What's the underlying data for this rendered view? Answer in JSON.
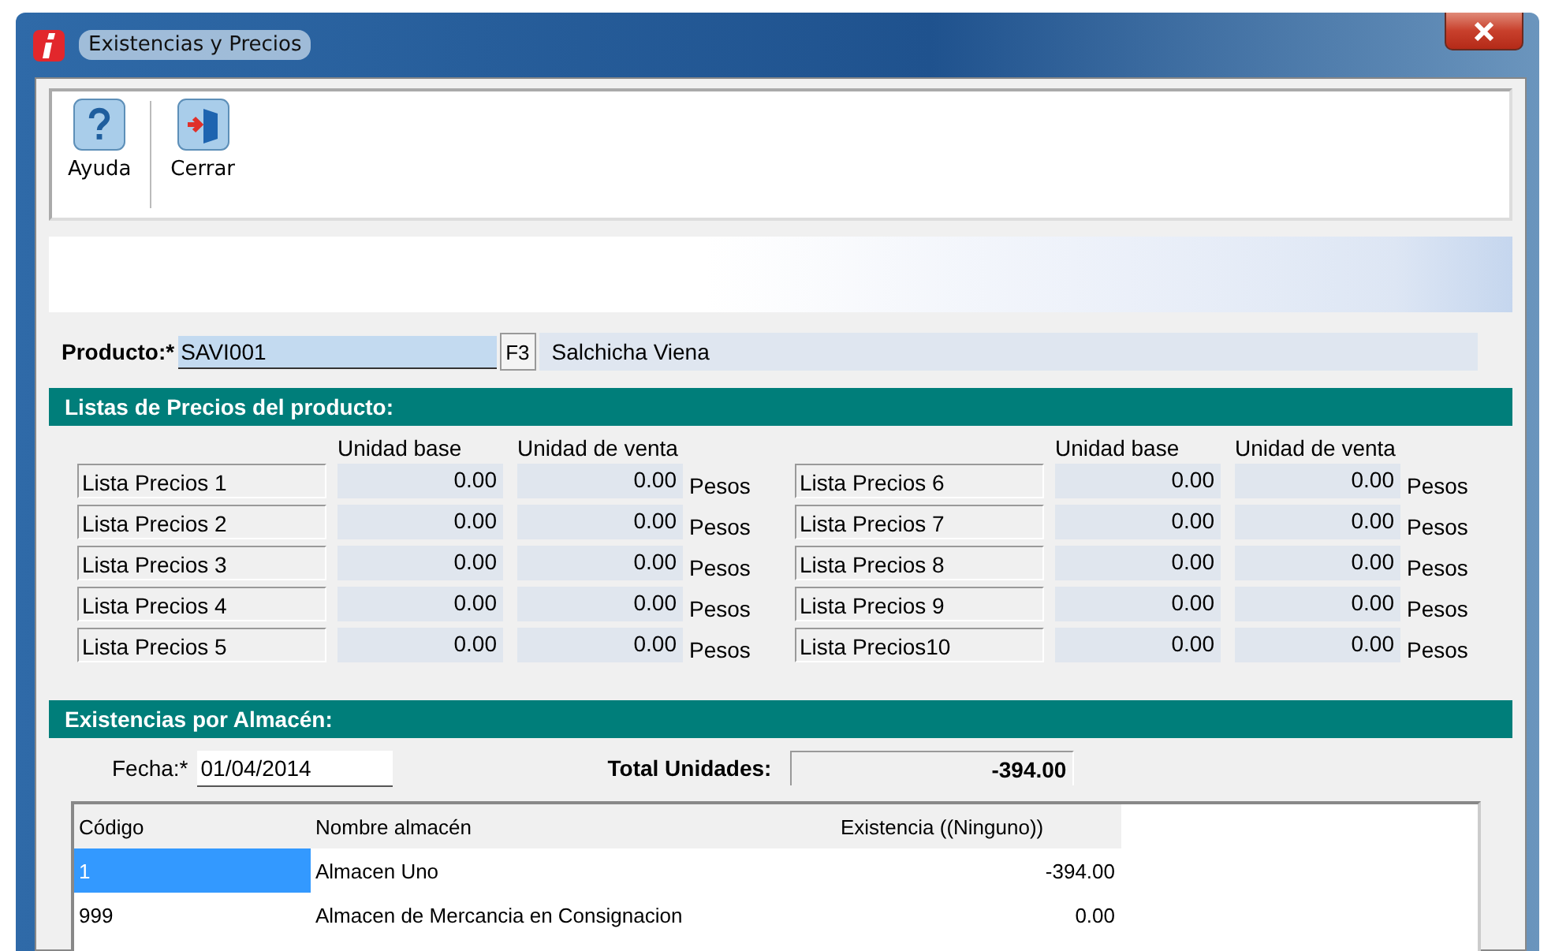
{
  "window": {
    "title": "Existencias y Precios"
  },
  "toolbar": [
    {
      "kind": "help",
      "label": "Ayuda"
    },
    {
      "kind": "close",
      "label": "Cerrar"
    }
  ],
  "product": {
    "label": "Producto:*",
    "value": "SAVI001",
    "lookup_key": "F3",
    "description": "Salchicha Viena"
  },
  "price_section": {
    "title": "Listas de Precios del producto:",
    "halves": [
      {
        "headers": [
          "Unidad base",
          "Unidad de venta"
        ],
        "lists": [
          {
            "name": "Lista Precios 1",
            "base": "0.00",
            "sale": "0.00",
            "currency": "Pesos"
          },
          {
            "name": "Lista Precios 2",
            "base": "0.00",
            "sale": "0.00",
            "currency": "Pesos"
          },
          {
            "name": "Lista Precios 3",
            "base": "0.00",
            "sale": "0.00",
            "currency": "Pesos"
          },
          {
            "name": "Lista Precios 4",
            "base": "0.00",
            "sale": "0.00",
            "currency": "Pesos"
          },
          {
            "name": "Lista Precios 5",
            "base": "0.00",
            "sale": "0.00",
            "currency": "Pesos"
          }
        ]
      },
      {
        "headers": [
          "Unidad base",
          "Unidad de venta"
        ],
        "lists": [
          {
            "name": "Lista Precios 6",
            "base": "0.00",
            "sale": "0.00",
            "currency": "Pesos"
          },
          {
            "name": "Lista Precios 7",
            "base": "0.00",
            "sale": "0.00",
            "currency": "Pesos"
          },
          {
            "name": "Lista Precios 8",
            "base": "0.00",
            "sale": "0.00",
            "currency": "Pesos"
          },
          {
            "name": "Lista Precios 9",
            "base": "0.00",
            "sale": "0.00",
            "currency": "Pesos"
          },
          {
            "name": "Lista Precios10",
            "base": "0.00",
            "sale": "0.00",
            "currency": "Pesos"
          }
        ]
      }
    ]
  },
  "stock_section": {
    "title": "Existencias por Almacén:",
    "date_label": "Fecha:*",
    "date": "01/04/2014",
    "total_label": "Total Unidades:",
    "total": "-394.00",
    "table": {
      "columns": [
        "Código",
        "Nombre almacén",
        "Existencia ((Ninguno))"
      ],
      "rows": [
        {
          "code": "1",
          "name": "Almacen Uno",
          "stock": "-394.00",
          "selected": true
        },
        {
          "code": "999",
          "name": "Almacen de Mercancia en Consignacion",
          "stock": "0.00",
          "selected": false
        }
      ]
    }
  }
}
